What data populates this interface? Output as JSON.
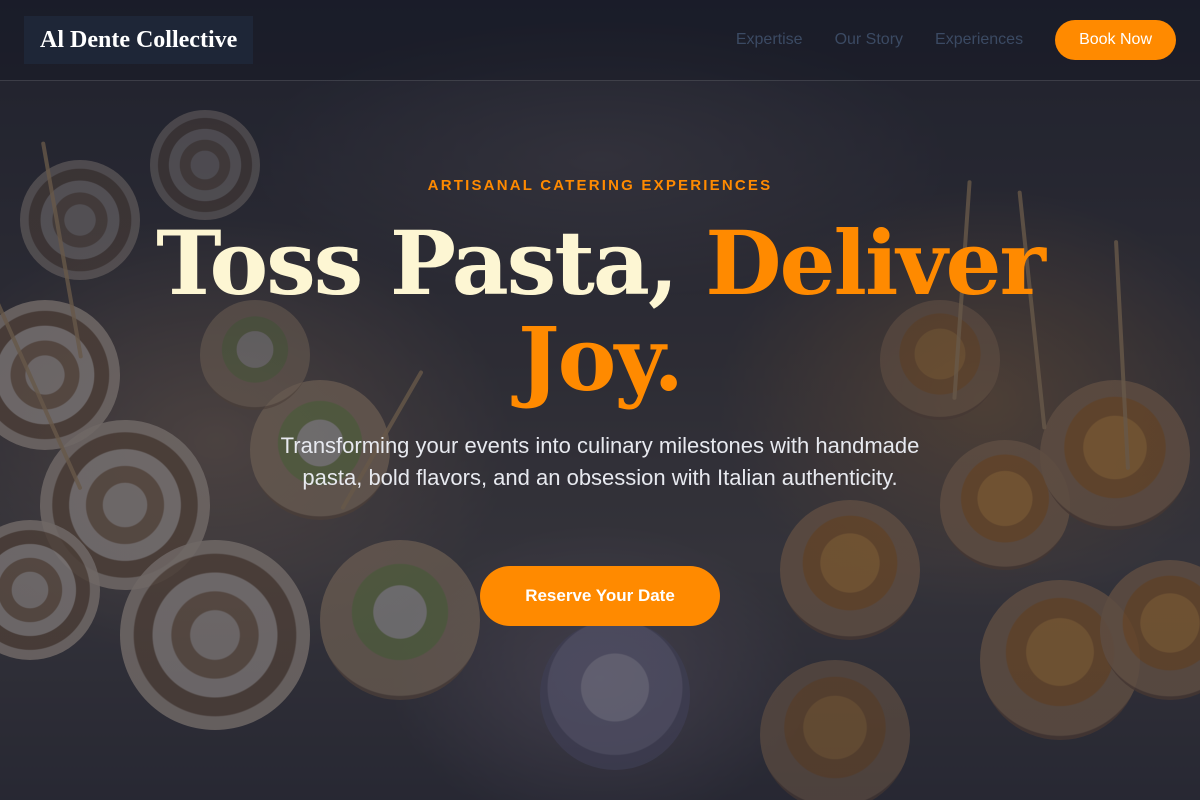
{
  "brand": {
    "name": "Al Dente Collective"
  },
  "nav": {
    "links": [
      {
        "label": "Expertise"
      },
      {
        "label": "Our Story"
      },
      {
        "label": "Experiences"
      }
    ],
    "cta_label": "Book Now"
  },
  "hero": {
    "eyebrow": "ARTISANAL CATERING EXPERIENCES",
    "headline_main": "Toss Pasta, ",
    "headline_accent": "Deliver Joy.",
    "subtitle": "Transforming your events into culinary milestones with handmade pasta, bold flavors, and an obsession with Italian authenticity.",
    "cta_label": "Reserve Your Date"
  },
  "colors": {
    "accent": "#ff8a00",
    "headline": "#fdf6d3",
    "logo_bg": "#1e2637",
    "nav_text": "#3b4a63"
  },
  "background": {
    "subject": "catering-appetizers-photo"
  }
}
